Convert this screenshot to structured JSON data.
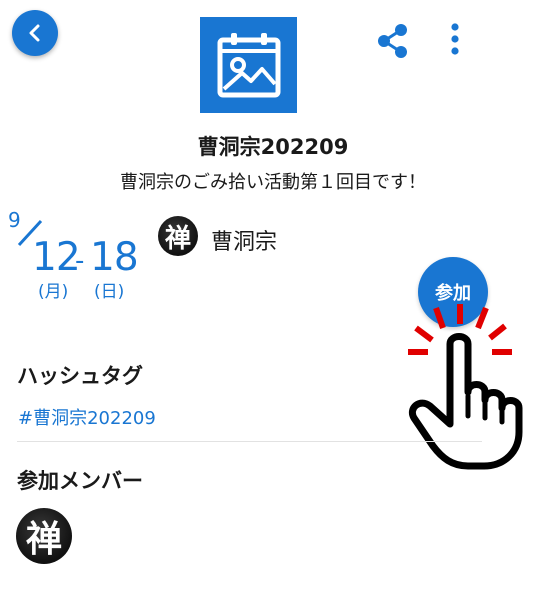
{
  "header": {
    "back_icon": "chevron-left-icon",
    "share_icon": "share-icon",
    "more_icon": "more-vertical-icon",
    "event_icon": "calendar-image-icon",
    "accent_color": "#1976d2"
  },
  "event": {
    "title": "曹洞宗202209",
    "description": "曹洞宗のごみ拾い活動第１回目です！",
    "date": {
      "month": "9",
      "start_day": "12",
      "separator": "-",
      "end_day": "18",
      "start_weekday": "(月)",
      "end_weekday": "(日)"
    },
    "organizer": {
      "avatar_glyph": "禅",
      "name": "曹洞宗"
    },
    "join_label": "参加"
  },
  "hashtags": {
    "heading": "ハッシュタグ",
    "items": [
      "#曹洞宗202209"
    ]
  },
  "members": {
    "heading": "参加メンバー",
    "avatars": [
      "禅"
    ]
  },
  "overlay": {
    "icon": "tap-hand-icon"
  }
}
